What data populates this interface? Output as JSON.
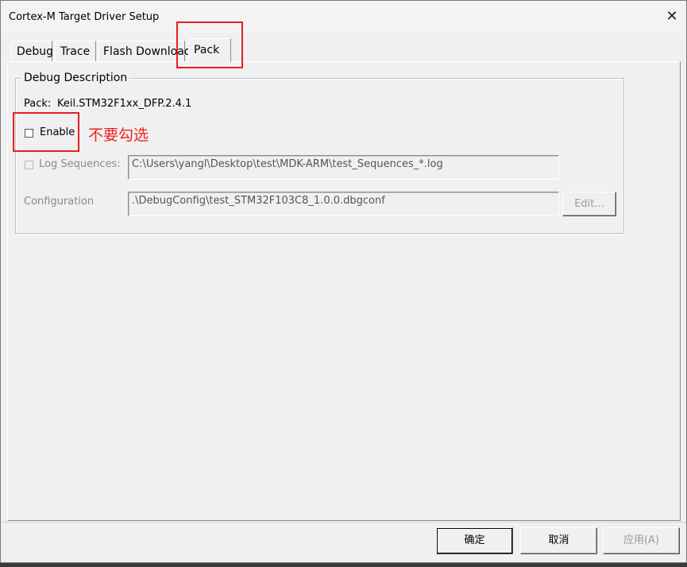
{
  "window": {
    "title": "Cortex-M Target Driver Setup",
    "close_glyph": "✕"
  },
  "tabs": [
    {
      "label": "Debug"
    },
    {
      "label": "Trace"
    },
    {
      "label": "Flash Download"
    },
    {
      "label": "Pack",
      "active": true
    }
  ],
  "debug_description": {
    "legend": "Debug Description",
    "pack_label": "Pack:",
    "pack_value": "Keil.STM32F1xx_DFP.2.4.1",
    "enable_label": "Enable",
    "enable_checked": false,
    "log_sequences_label": "Log Sequences:",
    "log_sequences_value": "C:\\Users\\yangl\\Desktop\\test\\MDK-ARM\\test_Sequences_*.log",
    "configuration_label": "Configuration",
    "configuration_value": ".\\DebugConfig\\test_STM32F103C8_1.0.0.dbgconf",
    "edit_button": "Edit..."
  },
  "annotation": {
    "text": "不要勾选",
    "color": "#ee2222"
  },
  "footer": {
    "ok": "确定",
    "cancel": "取消",
    "apply": "应用(A)"
  }
}
